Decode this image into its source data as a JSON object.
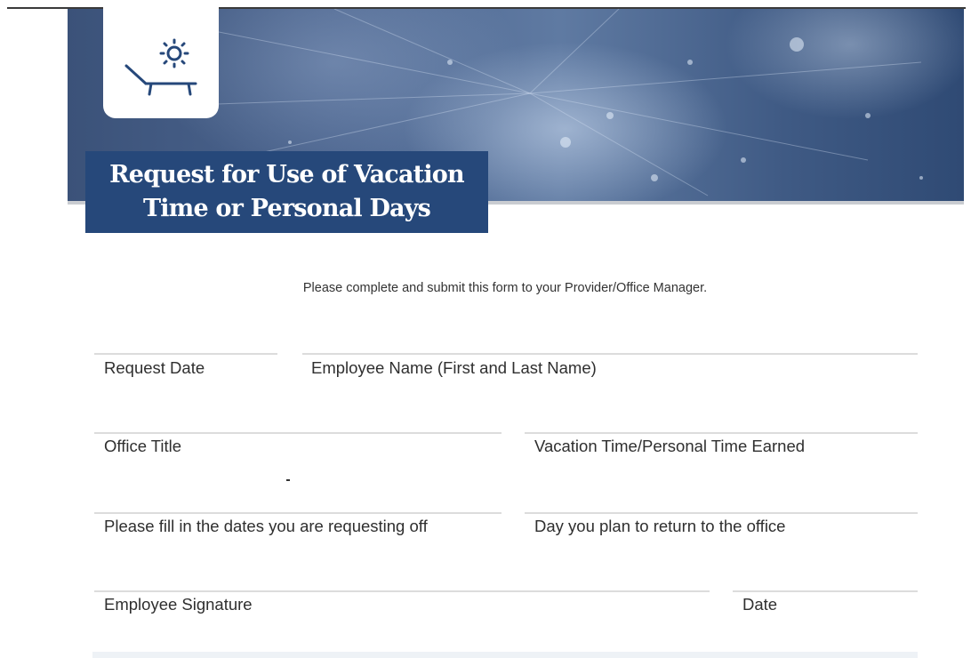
{
  "form": {
    "title": "Request for Use of Vacation\nTime or Personal Days",
    "instruction": "Please complete and submit this form to your Provider/Office Manager.",
    "icon": "lounge-chair-sun-icon",
    "colors": {
      "title_bg": "#26487a",
      "banner": "#4d6690"
    },
    "fields": {
      "request_date": "Request Date",
      "employee_name": "Employee Name (First and Last Name)",
      "office_title": "Office Title",
      "time_earned": "Vacation Time/Personal Time Earned",
      "dates_off": "Please fill in the dates you are requesting off",
      "return_day": "Day you plan to return to the office",
      "signature": "Employee Signature",
      "date": "Date"
    }
  }
}
